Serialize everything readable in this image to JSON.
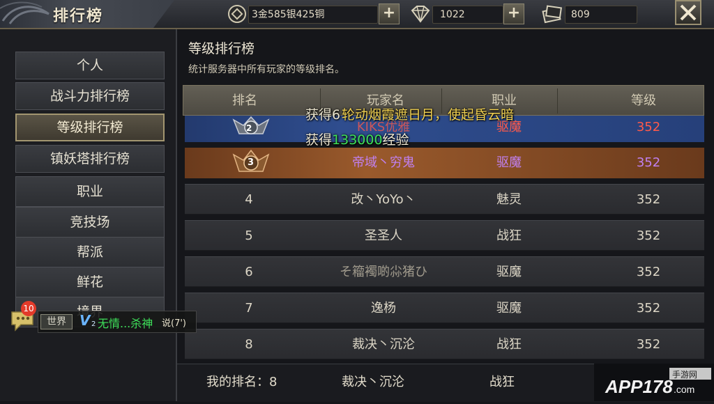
{
  "window": {
    "title": "排行榜"
  },
  "resources": {
    "currency": "3金585银425铜",
    "diamonds": "1022",
    "tickets": "809",
    "plus_label": "+"
  },
  "menu": {
    "items": [
      {
        "label": "个人",
        "active": false
      },
      {
        "label": "战斗力排行榜",
        "active": false
      },
      {
        "label": "等级排行榜",
        "active": true
      },
      {
        "label": "镇妖塔排行榜",
        "active": false
      },
      {
        "label": "职业",
        "active": false
      },
      {
        "label": "竞技场",
        "active": false
      },
      {
        "label": "帮派",
        "active": false
      },
      {
        "label": "鲜花",
        "active": false
      },
      {
        "label": "境界",
        "active": false
      }
    ]
  },
  "panel": {
    "heading": "等级排行榜",
    "description": "统计服务器中所有玩家的等级排名。"
  },
  "table": {
    "headers": [
      "排名",
      "玩家名",
      "职业",
      "等级"
    ],
    "rows": [
      {
        "rank": "2",
        "name": "KIKS优雅",
        "job": "驱魔",
        "level": "352",
        "style": "blue"
      },
      {
        "rank": "3",
        "name": "帝域丶穷鬼",
        "job": "驱魔",
        "level": "352",
        "style": "bronze"
      },
      {
        "rank": "4",
        "name": "改丶YoYo丶",
        "job": "魅灵",
        "level": "352",
        "style": "normal"
      },
      {
        "rank": "5",
        "name": "圣圣人",
        "job": "战狂",
        "level": "352",
        "style": "normal"
      },
      {
        "rank": "6",
        "name": "そ籕襡啲尛猪ひ",
        "job": "驱魔",
        "level": "352",
        "style": "normal"
      },
      {
        "rank": "7",
        "name": "逸杨",
        "job": "驱魔",
        "level": "352",
        "style": "normal"
      },
      {
        "rank": "8",
        "name": "裁决丶沉沦",
        "job": "战狂",
        "level": "352",
        "style": "normal"
      }
    ]
  },
  "my_rank": {
    "label": "我的排名：8",
    "name": "裁决丶沉沦",
    "job": "战狂"
  },
  "floating": {
    "gain_partial": "获得6",
    "skill_text": "轮动烟霞遮日月，使起昏云暗",
    "exp_prefix": "获得",
    "exp_value": "133000",
    "exp_suffix": "经验"
  },
  "chat": {
    "unread": "10",
    "channel": "世界",
    "vip": "V",
    "vip_level": "2",
    "speaker": "无情...杀神",
    "said": "说(7')"
  },
  "watermark": {
    "text": "APP178.com",
    "sub": "手游网"
  },
  "colors": {
    "accent_gold": "#a39670",
    "name_purple": "#c080f0",
    "level_red": "#ff5a4a",
    "exp_green": "#3ee05a",
    "skill_gold": "#f0d050"
  },
  "icons": [
    "coin-icon",
    "diamond-icon",
    "ticket-icon",
    "close-icon",
    "rank-2-badge-icon",
    "rank-3-badge-icon",
    "chat-bubble-icon"
  ]
}
